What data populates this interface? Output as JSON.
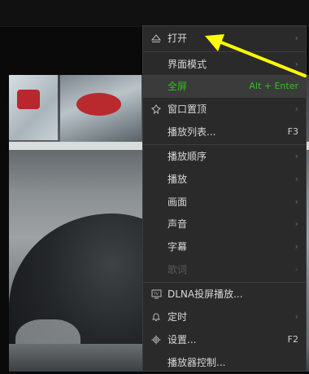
{
  "menu": {
    "items": [
      {
        "label": "打开",
        "icon": "eject-icon",
        "submenu": true
      },
      {
        "label": "界面模式",
        "icon": "",
        "submenu": true
      },
      {
        "label": "全屏",
        "icon": "",
        "shortcut": "Alt + Enter",
        "active": true
      },
      {
        "label": "窗口置顶",
        "icon": "pin-icon",
        "submenu": true
      },
      {
        "label": "播放列表...",
        "icon": "",
        "shortcut": "F3"
      },
      {
        "label": "播放顺序",
        "icon": "",
        "submenu": true
      },
      {
        "label": "播放",
        "icon": "",
        "submenu": true
      },
      {
        "label": "画面",
        "icon": "",
        "submenu": true
      },
      {
        "label": "声音",
        "icon": "",
        "submenu": true
      },
      {
        "label": "字幕",
        "icon": "",
        "submenu": true
      },
      {
        "label": "歌词",
        "icon": "",
        "submenu": true,
        "disabled": true
      },
      {
        "label": "DLNA投屏播放...",
        "icon": "tv-icon"
      },
      {
        "label": "定时",
        "icon": "bell-icon",
        "submenu": true
      },
      {
        "label": "设置...",
        "icon": "gear-icon",
        "shortcut": "F2"
      },
      {
        "label": "播放器控制...",
        "icon": ""
      }
    ],
    "submenu_arrow": "›"
  },
  "colors": {
    "accent": "#2fc21f",
    "annotation": "#ffff00"
  }
}
